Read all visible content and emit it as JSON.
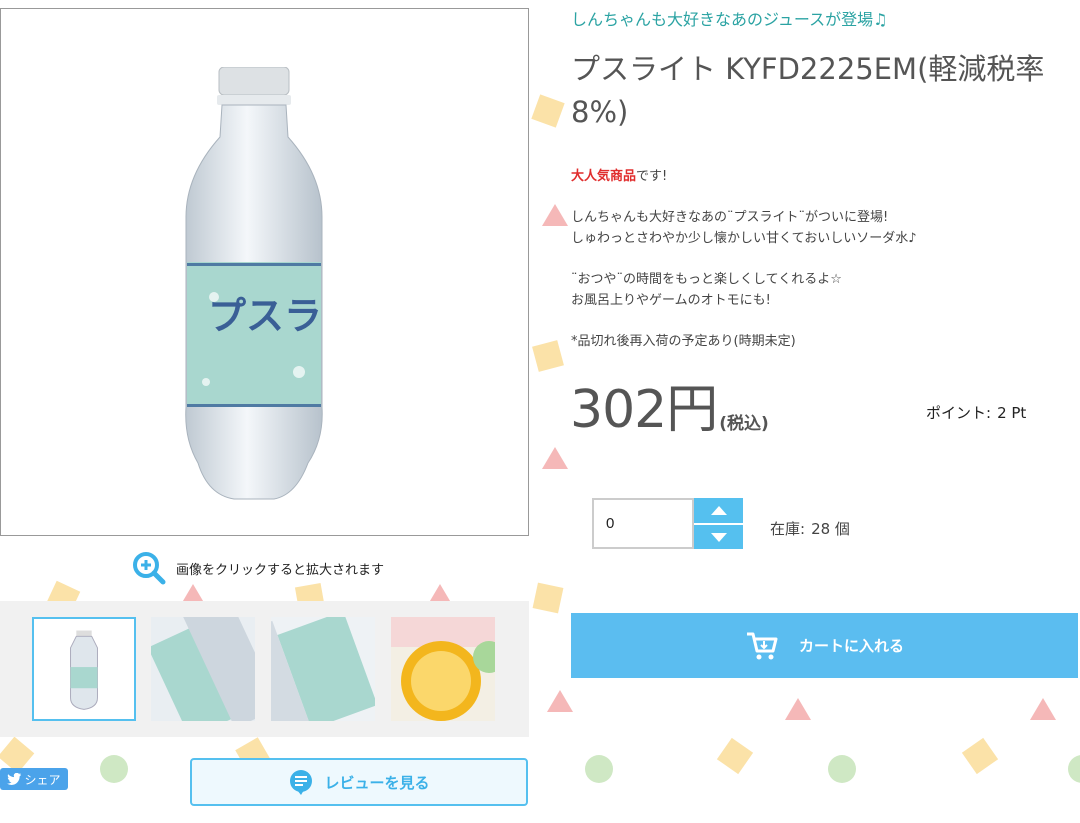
{
  "catchphrase": "しんちゃんも大好きなあのジュースが登場♫",
  "product": {
    "title": "プスライト KYFD2225EM(軽減税率8%)",
    "label_text": "プスライト"
  },
  "description": {
    "highlight": "大人気商品",
    "highlight_suffix": "です!",
    "para1_line1": "しんちゃんも大好きなあの¨プスライト¨がついに登場!",
    "para1_line2": "しゅわっとさわやか少し懐かしい甘くておいしいソーダ水♪",
    "para2_line1": "¨おつや¨の時間をもっと楽しくしてくれるよ☆",
    "para2_line2": "お風呂上りやゲームのオトモにも!",
    "note": "*品切れ後再入荷の予定あり(時期未定)"
  },
  "price": {
    "value": "302円",
    "tax_label": "(税込)"
  },
  "points": {
    "label": "ポイント:",
    "value": "2 Pt"
  },
  "quantity": {
    "value": "0"
  },
  "stock": {
    "label": "在庫:",
    "value": "28 個"
  },
  "buttons": {
    "cart": "カートに入れる",
    "review": "レビューを見る",
    "share": "シェア"
  },
  "zoom_hint": "画像をクリックすると拡大されます",
  "colors": {
    "accent_blue": "#55c0ef",
    "cart_button": "#5bbdf0",
    "catch_teal": "#2ba3a3",
    "highlight_red": "#e02d2d",
    "share_blue": "#4ba3ea"
  },
  "icons": [
    "zoom-in-icon",
    "cart-icon",
    "review-bubble-icon",
    "twitter-bird-icon",
    "chevron-up-icon",
    "chevron-down-icon"
  ]
}
